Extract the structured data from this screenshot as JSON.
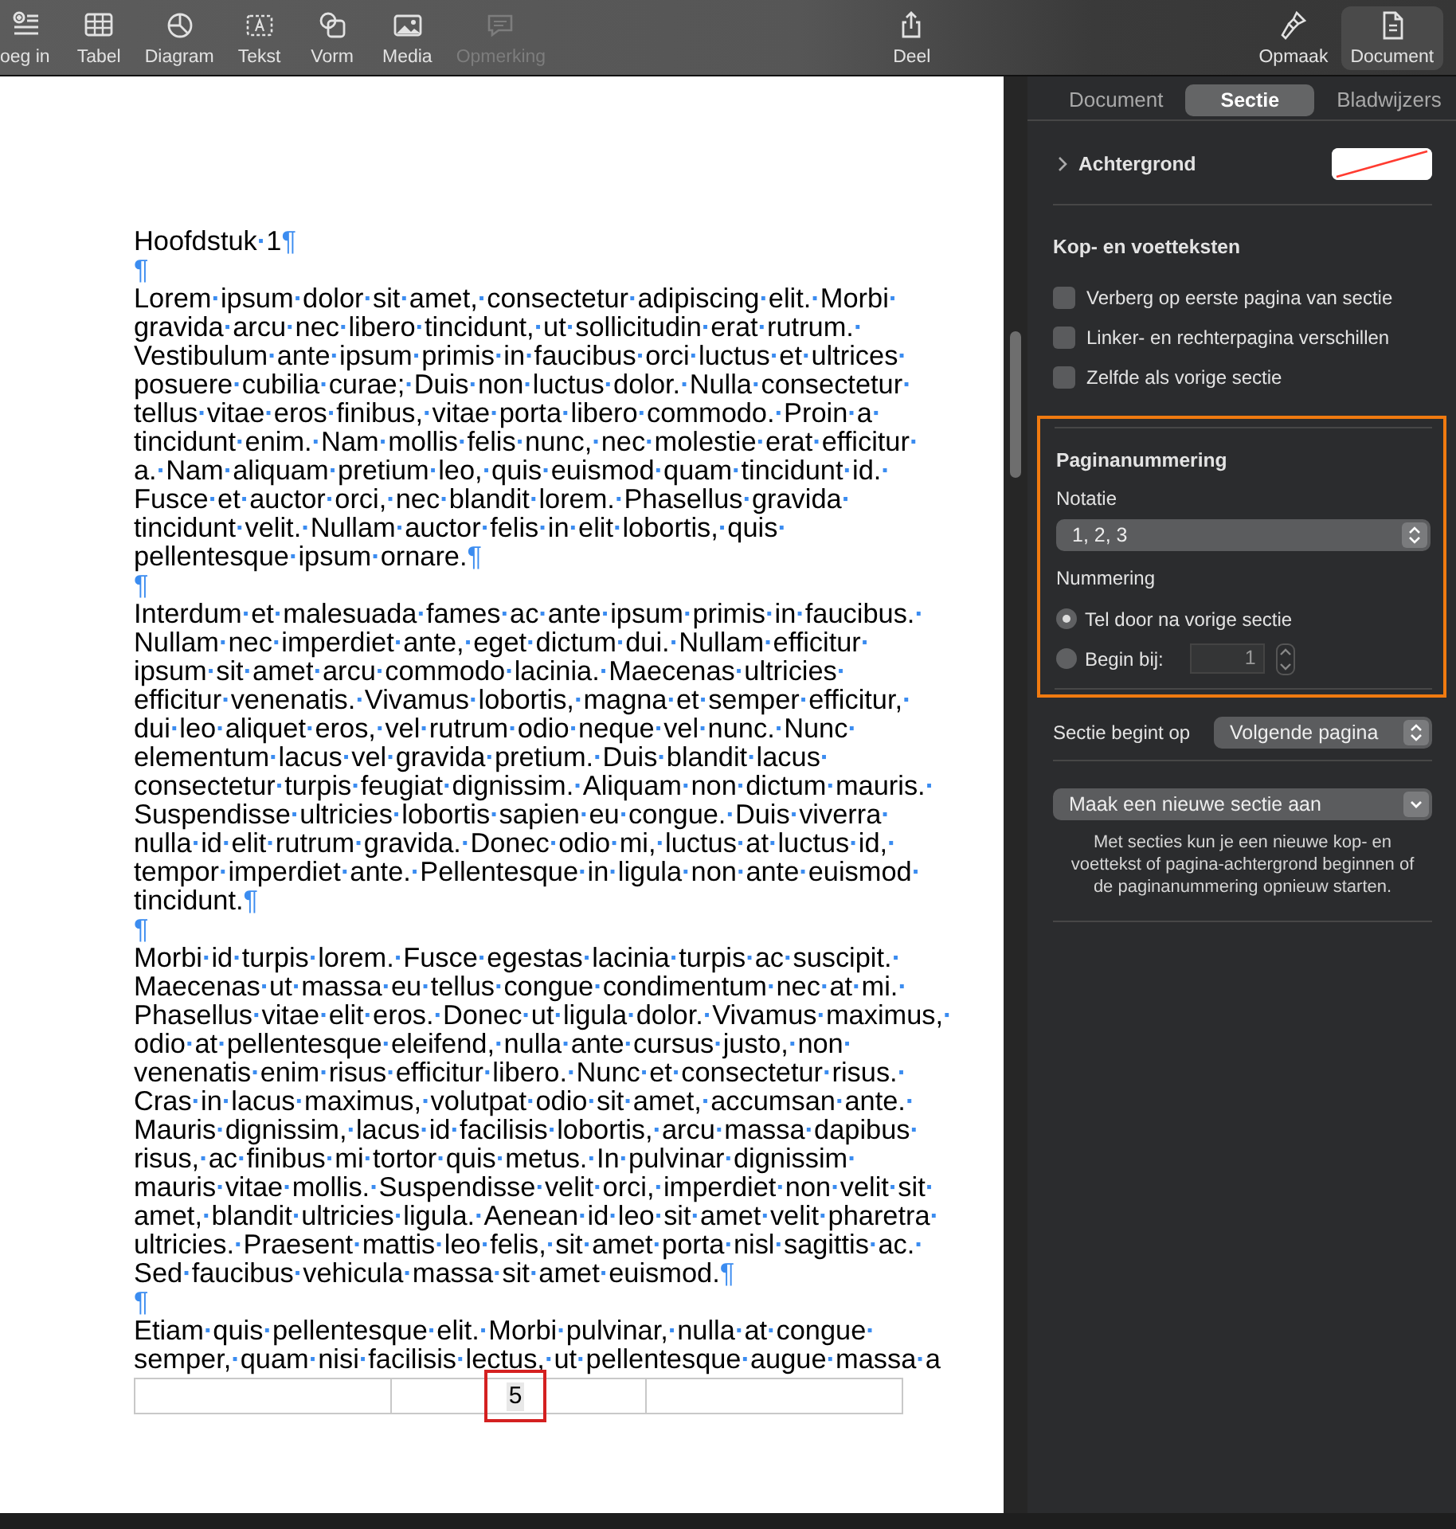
{
  "toolbar": {
    "items": [
      {
        "label": "oeg in",
        "disabled": false,
        "selected": false
      },
      {
        "label": "Tabel",
        "disabled": false,
        "selected": false
      },
      {
        "label": "Diagram",
        "disabled": false,
        "selected": false
      },
      {
        "label": "Tekst",
        "disabled": false,
        "selected": false
      },
      {
        "label": "Vorm",
        "disabled": false,
        "selected": false
      },
      {
        "label": "Media",
        "disabled": false,
        "selected": false
      },
      {
        "label": "Opmerking",
        "disabled": true,
        "selected": false
      },
      {
        "label": "Deel",
        "disabled": false,
        "selected": false
      },
      {
        "label": "Opmaak",
        "disabled": false,
        "selected": false
      },
      {
        "label": "Document",
        "disabled": false,
        "selected": true
      }
    ]
  },
  "document": {
    "lines": [
      "Hoofdstuk·1¶",
      "¶",
      "Lorem·ipsum·dolor·sit·amet,·consectetur·adipiscing·elit.·Morbi·",
      "gravida·arcu·nec·libero·tincidunt,·ut·sollicitudin·erat·rutrum.·",
      "Vestibulum·ante·ipsum·primis·in·faucibus·orci·luctus·et·ultrices·",
      "posuere·cubilia·curae;·Duis·non·luctus·dolor.·Nulla·consectetur·",
      "tellus·vitae·eros·finibus,·vitae·porta·libero·commodo.·Proin·a·",
      "tincidunt·enim.·Nam·mollis·felis·nunc,·nec·molestie·erat·efficitur·",
      "a.·Nam·aliquam·pretium·leo,·quis·euismod·quam·tincidunt·id.·",
      "Fusce·et·auctor·orci,·nec·blandit·lorem.·Phasellus·gravida·",
      "tincidunt·velit.·Nullam·auctor·felis·in·elit·lobortis,·quis·",
      "pellentesque·ipsum·ornare.¶",
      "¶",
      "Interdum·et·malesuada·fames·ac·ante·ipsum·primis·in·faucibus.·",
      "Nullam·nec·imperdiet·ante,·eget·dictum·dui.·Nullam·efficitur·",
      "ipsum·sit·amet·arcu·commodo·lacinia.·Maecenas·ultricies·",
      "efficitur·venenatis.·Vivamus·lobortis,·magna·et·semper·efficitur,·",
      "dui·leo·aliquet·eros,·vel·rutrum·odio·neque·vel·nunc.·Nunc·",
      "elementum·lacus·vel·gravida·pretium.·Duis·blandit·lacus·",
      "consectetur·turpis·feugiat·dignissim.·Aliquam·non·dictum·mauris.·",
      "Suspendisse·ultricies·lobortis·sapien·eu·congue.·Duis·viverra·",
      "nulla·id·elit·rutrum·gravida.·Donec·odio·mi,·luctus·at·luctus·id,·",
      "tempor·imperdiet·ante.·Pellentesque·in·ligula·non·ante·euismod·",
      "tincidunt.¶",
      "¶",
      "Morbi·id·turpis·lorem.·Fusce·egestas·lacinia·turpis·ac·suscipit.·",
      "Maecenas·ut·massa·eu·tellus·congue·condimentum·nec·at·mi.·",
      "Phasellus·vitae·elit·eros.·Donec·ut·ligula·dolor.·Vivamus·maximus,·",
      "odio·at·pellentesque·eleifend,·nulla·ante·cursus·justo,·non·",
      "venenatis·enim·risus·efficitur·libero.·Nunc·et·consectetur·risus.·",
      "Cras·in·lacus·maximus,·volutpat·odio·sit·amet,·accumsan·ante.·",
      "Mauris·dignissim,·lacus·id·facilisis·lobortis,·arcu·massa·dapibus·",
      "risus,·ac·finibus·mi·tortor·quis·metus.·In·pulvinar·dignissim·",
      "mauris·vitae·mollis.·Suspendisse·velit·orci,·imperdiet·non·velit·sit·",
      "amet,·blandit·ultricies·ligula.·Aenean·id·leo·sit·amet·velit·pharetra·",
      "ultricies.·Praesent·mattis·leo·felis,·sit·amet·porta·nisl·sagittis·ac.·",
      "Sed·faucibus·vehicula·massa·sit·amet·euismod.¶",
      "¶",
      "Etiam·quis·pellentesque·elit.·Morbi·pulvinar,·nulla·at·congue·",
      "semper,·quam·nisi·facilisis·lectus,·ut·pellentesque·augue·massa·a"
    ],
    "footer": {
      "page_number": "5",
      "highlighted": true
    }
  },
  "inspector": {
    "tabs": [
      {
        "label": "Document",
        "selected": false
      },
      {
        "label": "Sectie",
        "selected": true
      },
      {
        "label": "Bladwijzers",
        "selected": false
      }
    ],
    "background": {
      "label": "Achtergrond",
      "expanded": false
    },
    "headers_footers": {
      "title": "Kop- en voetteksten",
      "options": [
        {
          "label": "Verberg op eerste pagina van sectie",
          "checked": false
        },
        {
          "label": "Linker- en rechterpagina verschillen",
          "checked": false
        },
        {
          "label": "Zelfde als vorige sectie",
          "checked": false
        }
      ]
    },
    "page_numbering": {
      "title": "Paginanummering",
      "highlighted": true,
      "format_label": "Notatie",
      "format": "1, 2, 3",
      "numbering_label": "Nummering",
      "options": [
        {
          "label": "Tel door na vorige sectie",
          "selected": true
        },
        {
          "label": "Begin bij:",
          "selected": false,
          "kind": "start"
        }
      ],
      "start_value": "1"
    },
    "section_start": {
      "label": "Sectie begint op",
      "value": "Volgende pagina"
    },
    "new_section": {
      "label": "Maak een nieuwe sectie aan",
      "help": "Met secties kun je een nieuwe kop- en voettekst of pagina-achtergrond beginnen of de paginanummering opnieuw starten."
    }
  }
}
